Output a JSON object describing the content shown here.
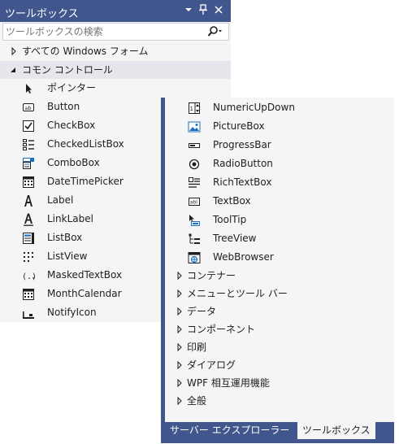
{
  "left_window": {
    "title": "ツールボックス",
    "search_placeholder": "ツールボックスの検索",
    "categories": [
      {
        "label": "すべての Windows フォーム",
        "expanded": false
      },
      {
        "label": "コモン コントロール",
        "expanded": true
      }
    ],
    "items": [
      {
        "label": "ポインター",
        "icon": "pointer-icon"
      },
      {
        "label": "Button",
        "icon": "button-icon"
      },
      {
        "label": "CheckBox",
        "icon": "checkbox-icon"
      },
      {
        "label": "CheckedListBox",
        "icon": "checkedlistbox-icon"
      },
      {
        "label": "ComboBox",
        "icon": "combobox-icon"
      },
      {
        "label": "DateTimePicker",
        "icon": "datetimepicker-icon"
      },
      {
        "label": "Label",
        "icon": "label-icon"
      },
      {
        "label": "LinkLabel",
        "icon": "linklabel-icon"
      },
      {
        "label": "ListBox",
        "icon": "listbox-icon"
      },
      {
        "label": "ListView",
        "icon": "listview-icon"
      },
      {
        "label": "MaskedTextBox",
        "icon": "maskedtextbox-icon"
      },
      {
        "label": "MonthCalendar",
        "icon": "monthcalendar-icon"
      },
      {
        "label": "NotifyIcon",
        "icon": "notifyicon-icon"
      }
    ]
  },
  "right_window": {
    "items": [
      {
        "label": "NumericUpDown",
        "icon": "numericupdown-icon"
      },
      {
        "label": "PictureBox",
        "icon": "picturebox-icon"
      },
      {
        "label": "ProgressBar",
        "icon": "progressbar-icon"
      },
      {
        "label": "RadioButton",
        "icon": "radiobutton-icon"
      },
      {
        "label": "RichTextBox",
        "icon": "richtextbox-icon"
      },
      {
        "label": "TextBox",
        "icon": "textbox-icon"
      },
      {
        "label": "ToolTip",
        "icon": "tooltip-icon"
      },
      {
        "label": "TreeView",
        "icon": "treeview-icon"
      },
      {
        "label": "WebBrowser",
        "icon": "webbrowser-icon"
      }
    ],
    "categories": [
      {
        "label": "コンテナー"
      },
      {
        "label": "メニューとツール バー"
      },
      {
        "label": "データ"
      },
      {
        "label": "コンポーネント"
      },
      {
        "label": "印刷"
      },
      {
        "label": "ダイアログ"
      },
      {
        "label": "WPF 相互運用機能"
      },
      {
        "label": "全般"
      }
    ],
    "tabs": [
      {
        "label": "サーバー エクスプローラー",
        "active": false
      },
      {
        "label": "ツールボックス",
        "active": true
      }
    ]
  },
  "colors": {
    "title_bar": "#40568d",
    "panel_bg": "#f5f5f5",
    "expanded_category_bg": "#e6e7ed",
    "icon_blue": "#1e6fbf"
  }
}
